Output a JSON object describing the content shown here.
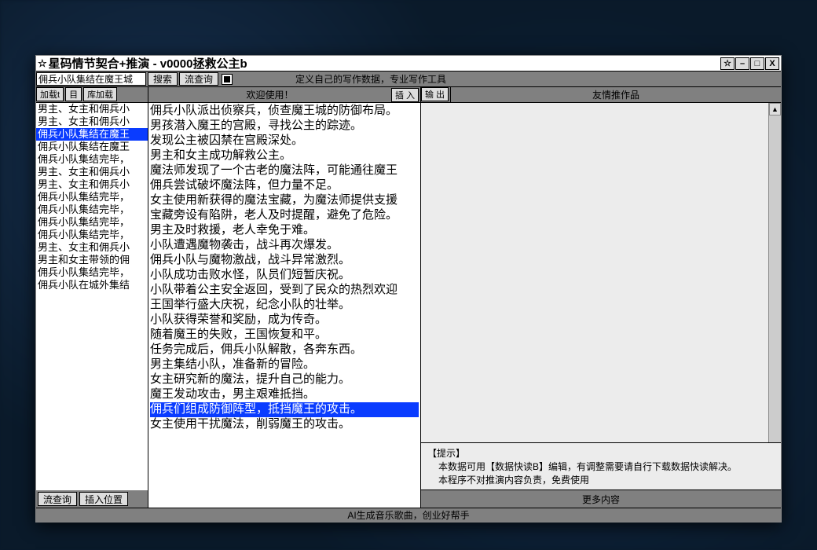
{
  "window": {
    "star_icon": "☆",
    "title": "星码情节契合+推演 - v0000拯救公主b",
    "controls": {
      "star": "☆",
      "min": "–",
      "max": "□",
      "close": "X"
    }
  },
  "toolbar1": {
    "address_value": "佣兵小队集结在魔王城",
    "search": "搜索",
    "flow_query": "流查询",
    "hint": "定义自己的写作数据，专业写作工具"
  },
  "toolbar2": {
    "load": "加载t",
    "catalog": "目",
    "lib_load": "库加载",
    "welcome": "欢迎使用！",
    "insert": "插 入",
    "output": "输 出",
    "recommend": "友情推作品"
  },
  "left_list": {
    "selected_index": 2,
    "items": [
      "男主、女主和佣兵小",
      "男主、女主和佣兵小",
      "佣兵小队集结在魔王",
      "佣兵小队集结在魔王",
      "佣兵小队集结完毕，",
      "男主、女主和佣兵小",
      "男主、女主和佣兵小",
      "佣兵小队集结完毕，",
      "佣兵小队集结完毕，",
      "佣兵小队集结完毕，",
      "佣兵小队集结完毕，",
      "男主、女主和佣兵小",
      "男主和女主带领的佣",
      "佣兵小队集结完毕，",
      "佣兵小队在城外集结"
    ]
  },
  "left_bottom": {
    "flow_query": "流查询",
    "insert_pos": "插入位置"
  },
  "mid_lines": {
    "highlight_index": 20,
    "lines": [
      "佣兵小队派出侦察兵，侦查魔王城的防御布局。",
      "男孩潜入魔王的宫殿，寻找公主的踪迹。",
      "发现公主被囚禁在宫殿深处。",
      "男主和女主成功解救公主。",
      "魔法师发现了一个古老的魔法阵，可能通往魔王",
      "佣兵尝试破坏魔法阵，但力量不足。",
      "女主使用新获得的魔法宝藏，为魔法师提供支援",
      "宝藏旁设有陷阱，老人及时提醒，避免了危险。",
      "男主及时救援，老人幸免于难。",
      "小队遭遇魔物袭击，战斗再次爆发。",
      "佣兵小队与魔物激战，战斗异常激烈。",
      "小队成功击败水怪，队员们短暂庆祝。",
      "小队带着公主安全返回，受到了民众的热烈欢迎",
      "王国举行盛大庆祝，纪念小队的壮举。",
      "小队获得荣誉和奖励，成为传奇。",
      "随着魔王的失败，王国恢复和平。",
      "任务完成后，佣兵小队解散，各奔东西。",
      "男主集结小队，准备新的冒险。",
      "女主研究新的魔法，提升自己的能力。",
      "魔王发动攻击，男主艰难抵挡。",
      "佣兵们组成防御阵型，抵挡魔王的攻击。",
      "女主使用干扰魔法，削弱魔王的攻击。"
    ]
  },
  "tips": {
    "title": "【提示】",
    "line1": "本数据可用【数据快读B】编辑，有调整需要请自行下载数据快读解决。",
    "line2": "本程序不对推演内容负责，免费使用"
  },
  "more": "更多内容",
  "footer": "AI生成音乐歌曲，创业好帮手"
}
